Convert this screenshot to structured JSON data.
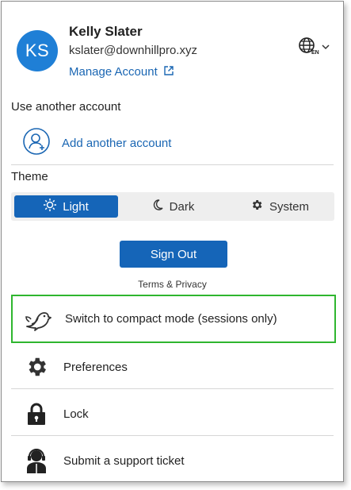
{
  "account": {
    "initials": "KS",
    "name": "Kelly Slater",
    "email": "kslater@downhillpro.xyz",
    "manage_label": "Manage Account",
    "language_code": "EN"
  },
  "sections": {
    "another_account_heading": "Use another account",
    "add_account_label": "Add another account",
    "theme_heading": "Theme"
  },
  "theme": {
    "options": [
      {
        "label": "Light",
        "icon": "sun-icon",
        "selected": true
      },
      {
        "label": "Dark",
        "icon": "moon-icon",
        "selected": false
      },
      {
        "label": "System",
        "icon": "gear-icon",
        "selected": false
      }
    ]
  },
  "actions": {
    "sign_out_label": "Sign Out",
    "terms_label": "Terms & Privacy"
  },
  "menu": [
    {
      "label": "Switch to compact mode (sessions only)",
      "icon": "bird-icon",
      "highlighted": true
    },
    {
      "label": "Preferences",
      "icon": "gear-icon"
    },
    {
      "label": "Lock",
      "icon": "lock-icon"
    },
    {
      "label": "Submit a support ticket",
      "icon": "support-agent-icon"
    }
  ],
  "colors": {
    "accent": "#1565b8",
    "link": "#1a66b3",
    "avatar": "#1f7fd6",
    "highlight_border": "#2fb62f"
  }
}
